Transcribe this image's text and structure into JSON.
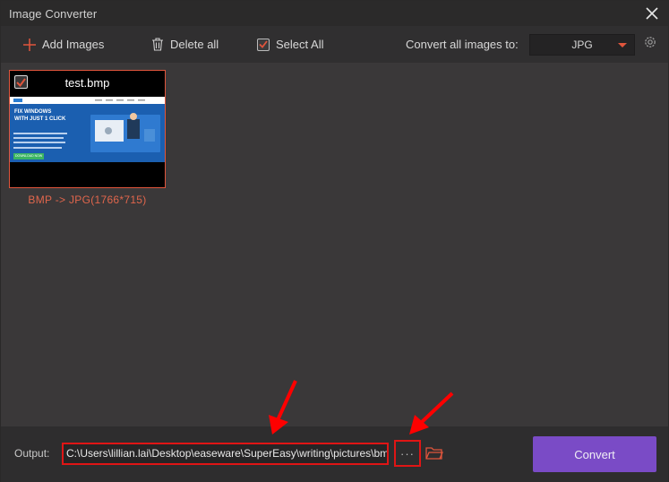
{
  "window": {
    "title": "Image Converter"
  },
  "toolbar": {
    "add_label": "Add Images",
    "delete_label": "Delete all",
    "select_label": "Select All",
    "select_checked": true,
    "convert_all_label": "Convert all images to:",
    "format_value": "JPG"
  },
  "images": [
    {
      "filename": "test.bmp",
      "checked": true,
      "caption": "BMP -> JPG(1766*715)",
      "thumb_text": {
        "headline": "FIX WINDOWS",
        "subline": "WITH JUST 1 CLICK",
        "button": "DOWNLOAD NOW"
      }
    }
  ],
  "output": {
    "label": "Output:",
    "path": "C:\\Users\\lillian.lai\\Desktop\\easeware\\SuperEasy\\writing\\pictures\\bmp",
    "more_label": "···"
  },
  "actions": {
    "convert_label": "Convert"
  },
  "colors": {
    "accent": "#e0553c",
    "convert_button": "#7a4bc6",
    "highlight_box": "#e01515"
  },
  "icons": [
    "close-icon",
    "plus-icon",
    "trash-icon",
    "checkbox-icon",
    "caret-down-icon",
    "gear-icon",
    "folder-icon",
    "arrow-annotation-icon"
  ]
}
